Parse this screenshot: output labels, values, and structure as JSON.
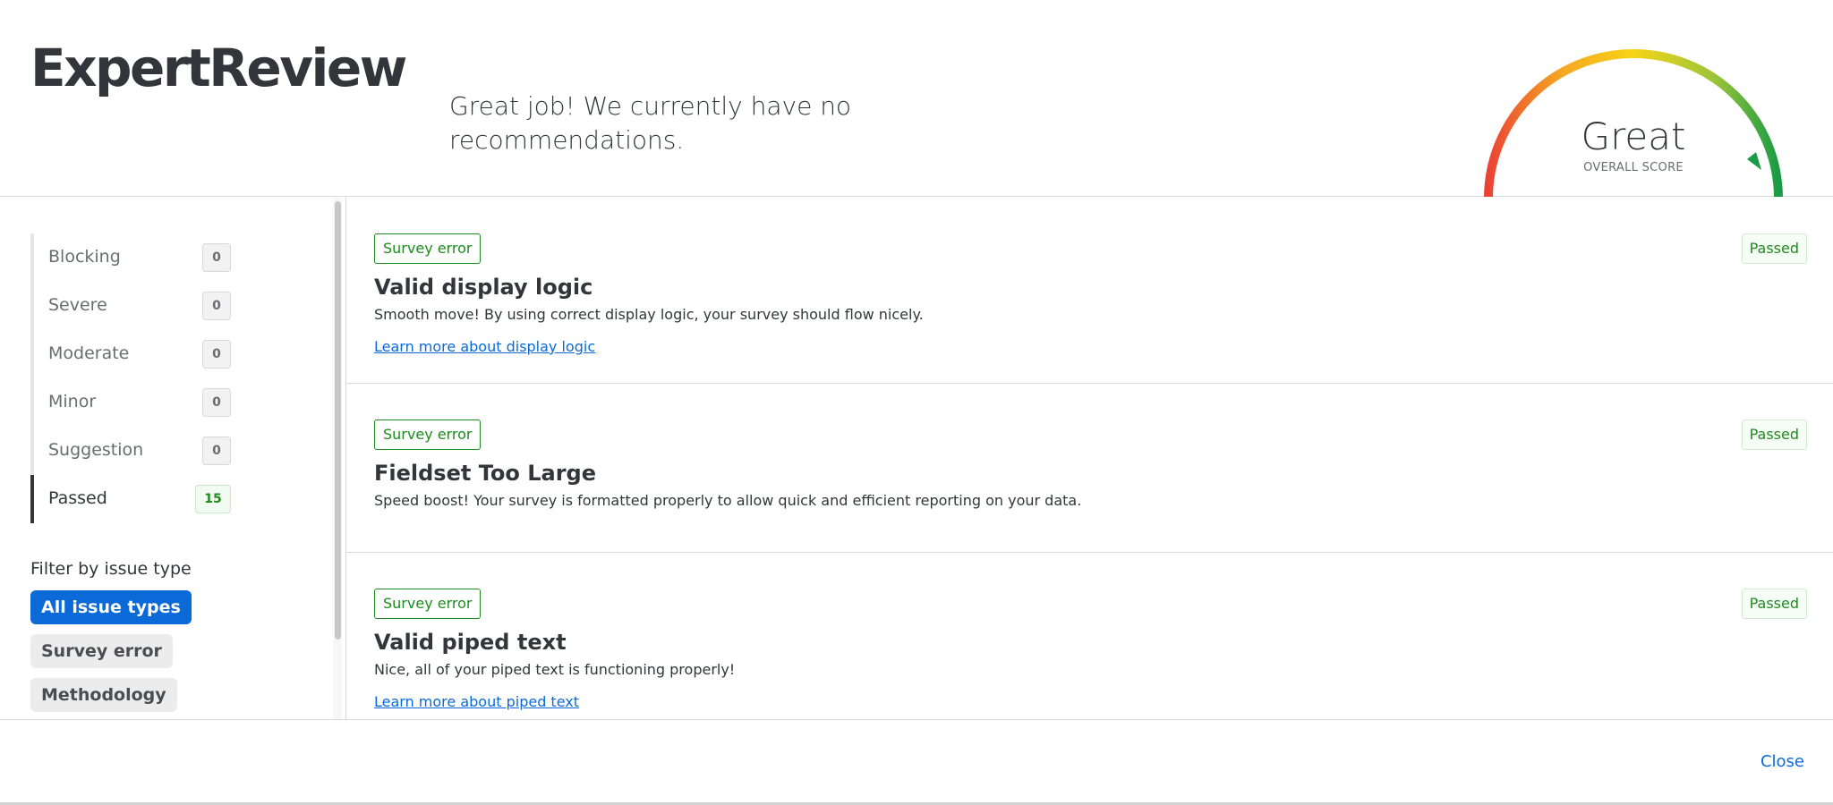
{
  "header": {
    "logo": "ExpertReview",
    "message": "Great job! We currently have no recommendations."
  },
  "gauge": {
    "score_text": "Great",
    "score_label": "OVERALL SCORE",
    "colors": [
      "#ea4335",
      "#f5a623",
      "#f7d417",
      "#9bc43a",
      "#1a9b45"
    ]
  },
  "sidebar": {
    "severity": [
      {
        "label": "Blocking",
        "count": "0"
      },
      {
        "label": "Severe",
        "count": "0"
      },
      {
        "label": "Moderate",
        "count": "0"
      },
      {
        "label": "Minor",
        "count": "0"
      },
      {
        "label": "Suggestion",
        "count": "0"
      },
      {
        "label": "Passed",
        "count": "15"
      }
    ],
    "filter_title": "Filter by issue type",
    "filters": [
      {
        "label": "All issue types"
      },
      {
        "label": "Survey error"
      },
      {
        "label": "Methodology"
      }
    ]
  },
  "cards": [
    {
      "tag": "Survey error",
      "status": "Passed",
      "title": "Valid display logic",
      "desc": "Smooth move! By using correct display logic, your survey should flow nicely.",
      "link": "Learn more about display logic"
    },
    {
      "tag": "Survey error",
      "status": "Passed",
      "title": "Fieldset Too Large",
      "desc": "Speed boost! Your survey is formatted properly to allow quick and efficient reporting on your data."
    },
    {
      "tag": "Survey error",
      "status": "Passed",
      "title": "Valid piped text",
      "desc": "Nice, all of your piped text is functioning properly!",
      "link": "Learn more about piped text"
    }
  ],
  "footer": {
    "close_label": "Close"
  }
}
